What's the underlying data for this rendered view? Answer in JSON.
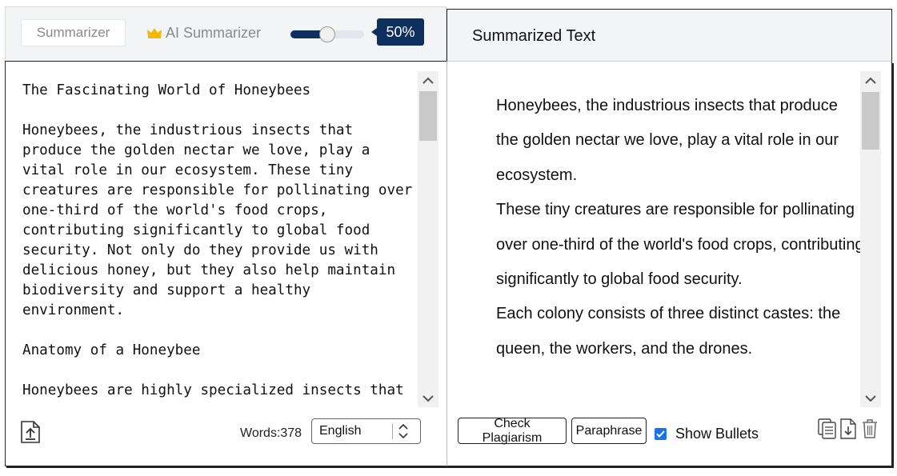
{
  "left_panel": {
    "tabs": [
      {
        "label": "Summarizer"
      },
      {
        "label": "AI Summarizer"
      }
    ],
    "slider": {
      "value_percent": 50,
      "badge": "50%"
    },
    "input_text": "The Fascinating World of Honeybees\n\nHoneybees, the industrious insects that produce the golden nectar we love, play a vital role in our ecosystem. These tiny creatures are responsible for pollinating over one-third of the world's food crops, contributing significantly to global food security. Not only do they provide us with delicious honey, but they also help maintain biodiversity and support a healthy environment.\n\nAnatomy of a Honeybee\n\nHoneybees are highly specialized insects that",
    "word_count_label": "Words:378",
    "language": {
      "selected": "English"
    },
    "icons": {
      "upload": "upload-file-icon",
      "premium": "crown-icon"
    }
  },
  "right_panel": {
    "title": "Summarized Text",
    "summary_bullets": [
      "Honeybees, the industrious insects that produce the golden nectar we love, play a vital role in our ecosystem.",
      "These tiny creatures are responsible for pollinating over one-third of the world's food crops, contributing significantly to global food security.",
      "Each colony consists of three distinct castes: the queen, the workers, and the drones."
    ],
    "buttons": {
      "check_plagiarism": "Check Plagiarism",
      "paraphrase": "Paraphrase"
    },
    "show_bullets": {
      "label": "Show Bullets",
      "checked": true
    },
    "icons": [
      "copy-icon",
      "download-icon",
      "delete-icon"
    ]
  },
  "colors": {
    "accent": "#0d2f5e",
    "crown": "#f5b800",
    "checkbox": "#1a73e8",
    "header_bg": "#f3f4f6"
  }
}
